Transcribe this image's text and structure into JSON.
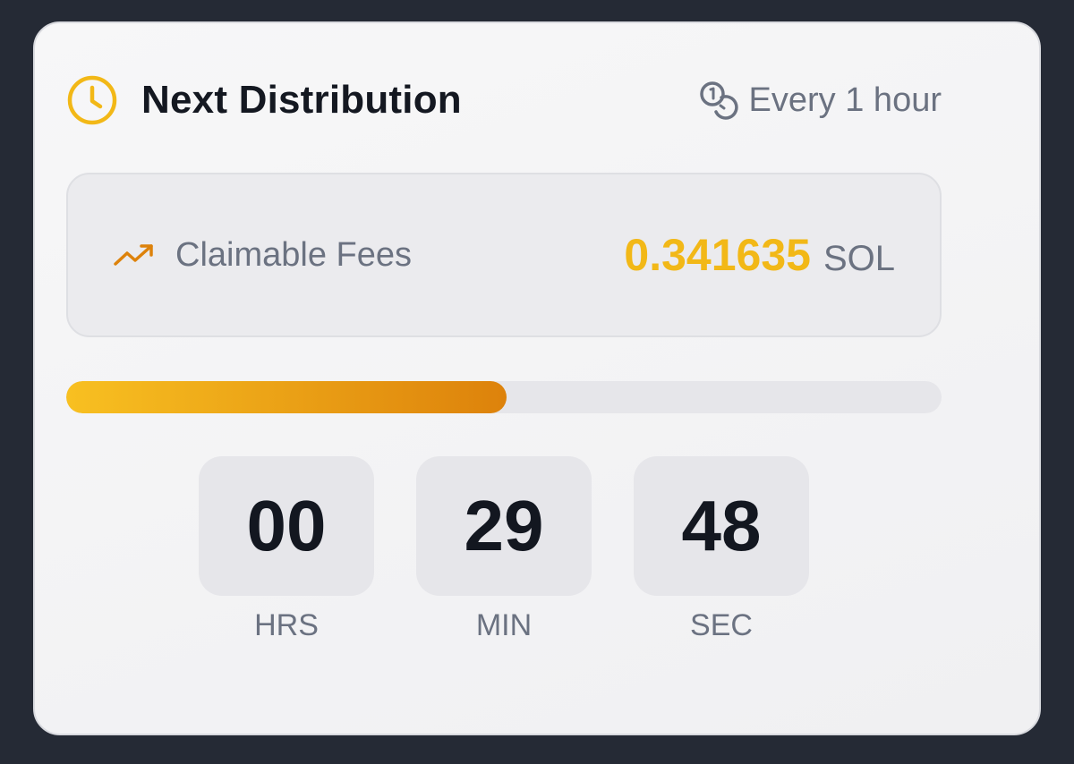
{
  "header": {
    "title": "Next Distribution",
    "frequency": "Every 1 hour",
    "clock_icon": "clock-icon",
    "coins_icon": "coins-icon"
  },
  "fees": {
    "label": "Claimable Fees",
    "value": "0.341635",
    "unit": "SOL",
    "trend_icon": "trending-up-icon"
  },
  "progress": {
    "fraction": 0.503
  },
  "timer": {
    "units": [
      {
        "value": "00",
        "label": "HRS"
      },
      {
        "value": "29",
        "label": "MIN"
      },
      {
        "value": "48",
        "label": "SEC"
      }
    ]
  },
  "colors": {
    "accent": "#f2b817",
    "accent_dark": "#dd820b",
    "text_muted": "#6b7281",
    "text_dark": "#141821"
  }
}
